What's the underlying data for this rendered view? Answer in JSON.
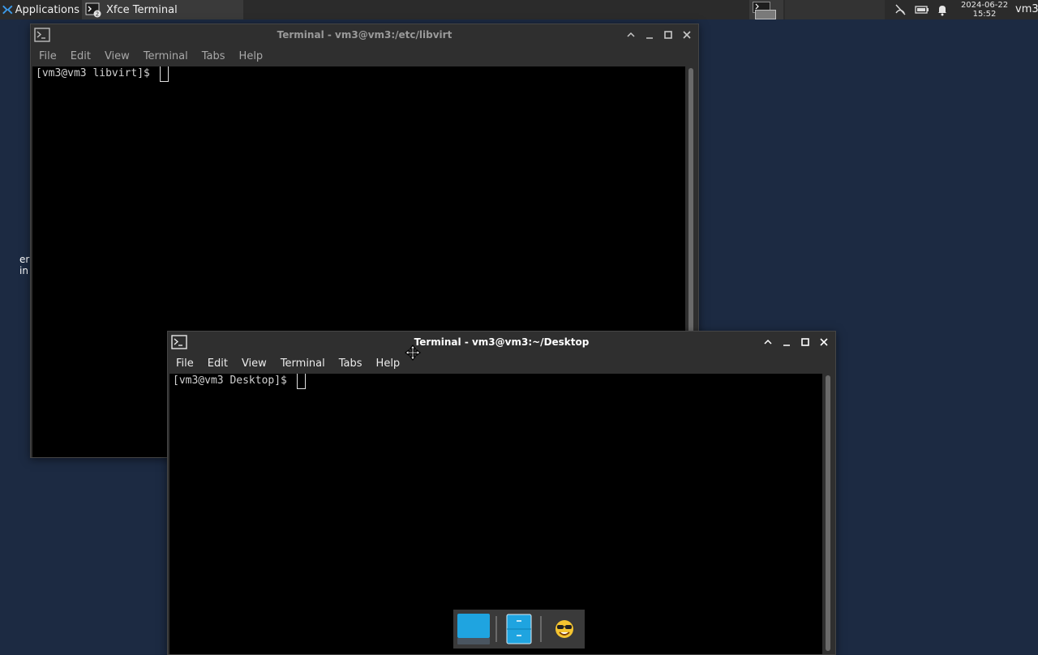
{
  "top_panel": {
    "applications_label": "Applications",
    "task_label": "Xfce Terminal",
    "clock_date": "2024-06-22",
    "clock_time": "15:52",
    "user_label": "vm3"
  },
  "desktop": {
    "leftover_text_1": "er",
    "leftover_text_2": "in"
  },
  "windows": [
    {
      "title": "Terminal - vm3@vm3:/etc/libvirt",
      "menu": [
        "File",
        "Edit",
        "View",
        "Terminal",
        "Tabs",
        "Help"
      ],
      "prompt": "[vm3@vm3 libvirt]$"
    },
    {
      "title": "Terminal - vm3@vm3:~/Desktop",
      "menu": [
        "File",
        "Edit",
        "View",
        "Terminal",
        "Tabs",
        "Help"
      ],
      "prompt": "[vm3@vm3 Desktop]$"
    }
  ],
  "dock": {
    "items": [
      "workspace-icon",
      "file-manager-icon",
      "emoji-icon"
    ]
  },
  "colors": {
    "desktop_bg": "#1c2a42",
    "panel_bg": "#2b2b2b",
    "window_bg": "#2f2f2f",
    "terminal_bg": "#000000",
    "dock_accent": "#1fa4e0"
  }
}
